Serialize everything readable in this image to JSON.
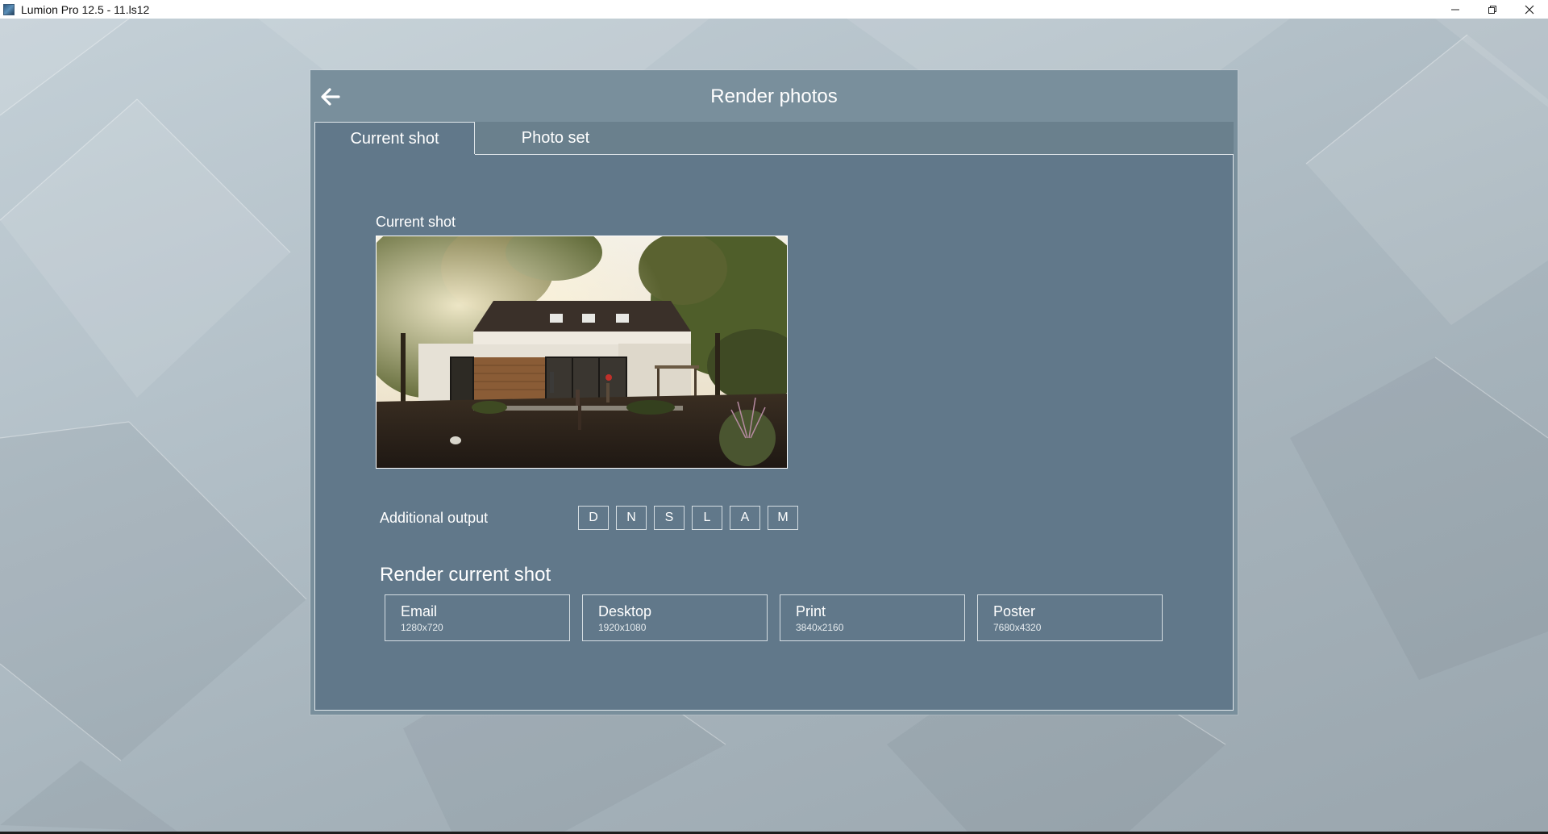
{
  "window": {
    "title": "Lumion Pro 12.5 - 11.ls12"
  },
  "dialog": {
    "title": "Render photos",
    "tabs": [
      {
        "label": "Current shot",
        "active": true
      },
      {
        "label": "Photo set",
        "active": false
      }
    ],
    "preview_label": "Current shot",
    "additional_output": {
      "label": "Additional output",
      "buttons": [
        "D",
        "N",
        "S",
        "L",
        "A",
        "M"
      ]
    },
    "render": {
      "heading": "Render current shot",
      "presets": [
        {
          "name": "Email",
          "resolution": "1280x720"
        },
        {
          "name": "Desktop",
          "resolution": "1920x1080"
        },
        {
          "name": "Print",
          "resolution": "3840x2160"
        },
        {
          "name": "Poster",
          "resolution": "7680x4320"
        }
      ]
    }
  },
  "icons": {
    "back": "arrow-left-icon",
    "minimize": "minimize-icon",
    "restore": "restore-icon",
    "close": "close-icon"
  },
  "colors": {
    "dialog_bg": "#798f9c",
    "panel_bg": "#61788a",
    "text": "#ffffff"
  }
}
